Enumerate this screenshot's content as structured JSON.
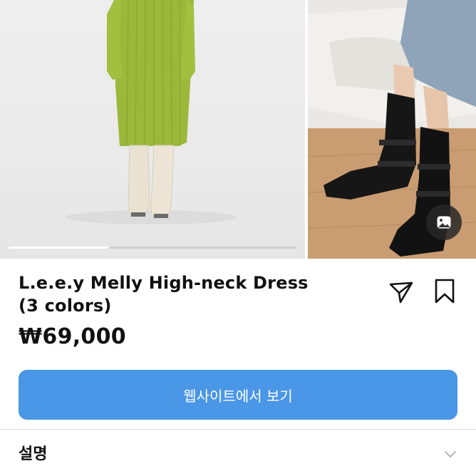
{
  "product": {
    "title": "L.e.e.y Melly High-neck Dress (3 colors)",
    "price": "₩69,000"
  },
  "gallery": {
    "main_image": "model-wearing-green-knit-dress",
    "side_image": "black-lace-up-combat-boots",
    "progress": 0.35,
    "media_icon": "image-icon"
  },
  "actions": {
    "share_icon": "send-icon",
    "save_icon": "bookmark-icon",
    "cta_label": "웹사이트에서 보기"
  },
  "description": {
    "label": "설명",
    "toggle_icon": "chevron-down-icon"
  },
  "colors": {
    "accent": "#4a96e7",
    "dress_green": "#9cb83a",
    "boots_black": "#161616"
  }
}
